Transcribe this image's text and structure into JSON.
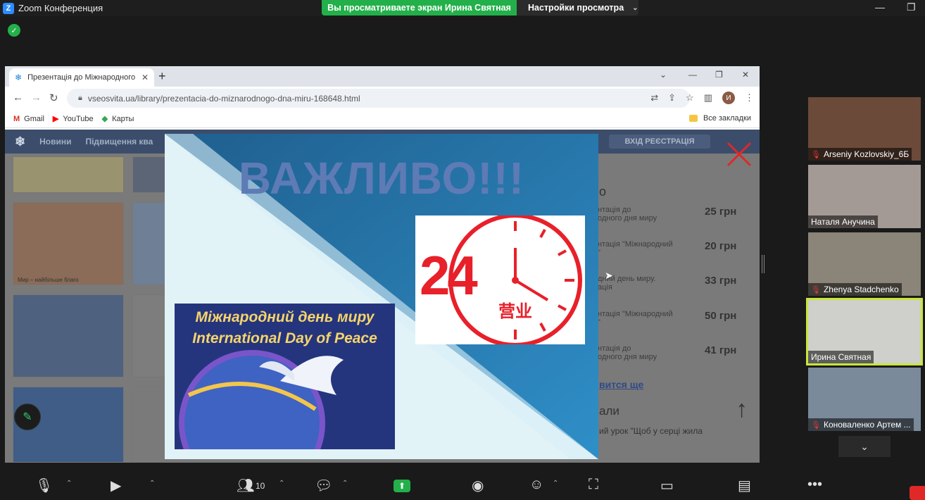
{
  "zoom": {
    "app_title": "Zoom Конференция",
    "share_banner": "Вы просматриваете экран Ирина Святная",
    "view_options": "Настройки просмотра"
  },
  "browser": {
    "tab_title": "Презентація до Міжнародного",
    "url": "vseosvita.ua/library/prezentacia-do-miznarodnogo-dna-miru-168648.html",
    "profile_initial": "И",
    "bookmarks": [
      "Gmail",
      "YouTube",
      "Карты"
    ],
    "all_bookmarks": "Все закладки"
  },
  "site": {
    "nav": [
      "Новини",
      "Підвищення ква"
    ],
    "login": "ВХІД  РЕЄСТРАЦІЯ",
    "heading_fragment": "о",
    "thumb_caption": "Мир – найбільше благо",
    "prices": [
      {
        "text": "нтація до\nодного дня миру",
        "price": "25 грн"
      },
      {
        "text": "нтація \"Міжнародний\n\"",
        "price": "20 грн"
      },
      {
        "text": "дний день миру.\nація",
        "price": "33 грн"
      },
      {
        "text": "нтація \"Міжнародний\n\"",
        "price": "50 грн"
      },
      {
        "text": "нтація до\nодного дня миру",
        "price": "41 грн"
      }
    ],
    "show_more": "вится ще",
    "lesson_heading": "али",
    "lesson_text": "ий урок \"Щоб у серці жила"
  },
  "slide": {
    "title": "ВАЖЛИВО!!!",
    "clock_number": "24",
    "clock_chars": "营业",
    "peace_line1": "Міжнародний день миру",
    "peace_line2": "International Day of Peace"
  },
  "participants": [
    {
      "name": "Arseniy Kozlovskiy_6Б",
      "muted": true
    },
    {
      "name": "Наталя Анучина",
      "muted": false
    },
    {
      "name": "Zhenya Stadchenko",
      "muted": true
    },
    {
      "name": "Ирина Святная",
      "muted": false
    },
    {
      "name": "Коноваленко Артем ...",
      "muted": true
    }
  ],
  "toolbar": {
    "participants_count": "10"
  },
  "colors": {
    "share_green": "#23b04a",
    "zoom_blue": "#2d8cff",
    "active_speaker": "#c8e63a",
    "slide_blue": "#2c7eb4",
    "title_blue": "#5e7bb6",
    "clock_red": "#e8202a"
  }
}
